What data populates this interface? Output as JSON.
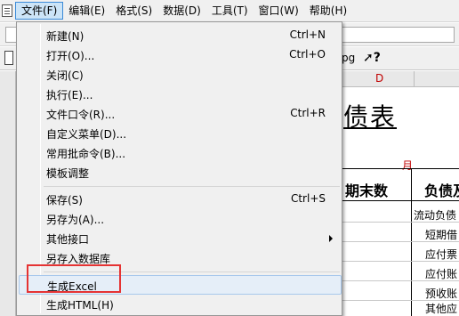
{
  "menubar": {
    "items": [
      {
        "label": "文件(F)",
        "active": true
      },
      {
        "label": "编辑(E)"
      },
      {
        "label": "格式(S)"
      },
      {
        "label": "数据(D)"
      },
      {
        "label": "工具(T)"
      },
      {
        "label": "窗口(W)"
      },
      {
        "label": "帮助(H)"
      }
    ]
  },
  "toolbar": {
    "pg_label": "pg",
    "help_label": "?"
  },
  "sheet": {
    "column_label": "D",
    "title": "债表",
    "month": "月",
    "header_col1": "期末数",
    "header_col2": "负债及",
    "rows": [
      "流动负债",
      "短期借",
      "应付票",
      "应付账",
      "预收账",
      "其他应"
    ]
  },
  "file_menu": {
    "items": [
      {
        "label": "新建(N)",
        "shortcut": "Ctrl+N"
      },
      {
        "label": "打开(O)...",
        "shortcut": "Ctrl+O"
      },
      {
        "label": "关闭(C)",
        "shortcut": ""
      },
      {
        "label": "执行(E)...",
        "shortcut": ""
      },
      {
        "label": "文件口令(R)...",
        "shortcut": "Ctrl+R"
      },
      {
        "label": "自定义菜单(D)...",
        "shortcut": ""
      },
      {
        "label": "常用批命令(B)...",
        "shortcut": ""
      },
      {
        "label": "模板调整",
        "shortcut": ""
      },
      {
        "label": "保存(S)",
        "shortcut": "Ctrl+S"
      },
      {
        "label": "另存为(A)...",
        "shortcut": ""
      },
      {
        "label": "其他接口",
        "shortcut": ""
      },
      {
        "label": "另存入数据库",
        "shortcut": ""
      },
      {
        "label": "生成Excel",
        "shortcut": ""
      },
      {
        "label": "生成HTML(H)",
        "shortcut": ""
      }
    ]
  }
}
